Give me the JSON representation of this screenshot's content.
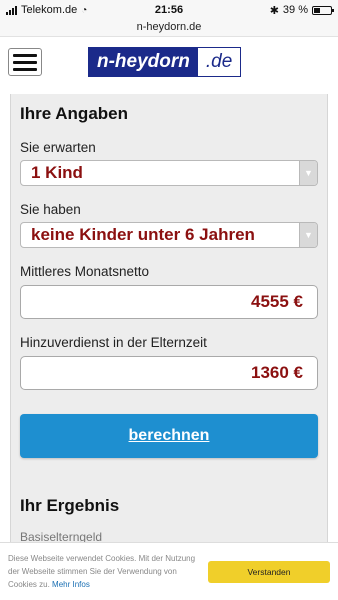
{
  "status_bar": {
    "carrier": "Telekom.de",
    "time": "21:56",
    "battery": "39 %",
    "battery_level": 0.39
  },
  "browser": {
    "url": "n-heydorn.de"
  },
  "header": {
    "logo_main": "n-heydorn",
    "logo_ext": ".de"
  },
  "form": {
    "heading": "Ihre Angaben",
    "expect_label": "Sie erwarten",
    "expect_value": "1 Kind",
    "have_label": "Sie haben",
    "have_value": "keine Kinder unter 6 Jahren",
    "income_label": "Mittleres Monatsnetto",
    "income_value": "4555 €",
    "extra_label": "Hinzuverdienst in der Elternzeit",
    "extra_value": "1360 €",
    "calc_label": "berechnen"
  },
  "result": {
    "heading": "Ihr Ergebnis",
    "partial_line": "Basiselterngeld"
  },
  "cookie": {
    "text": "Diese Webseite verwendet Cookies. Mit der Nutzung der Webseite stimmen Sie der Verwendung von Cookies zu.",
    "link": "Mehr Infos",
    "accept": "Verstanden"
  }
}
